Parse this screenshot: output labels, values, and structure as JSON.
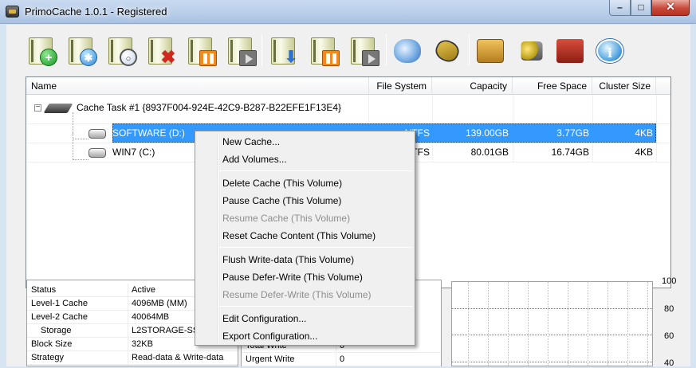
{
  "window": {
    "title": "PrimoCache 1.0.1 - Registered"
  },
  "title_bar_buttons": {
    "minimize": "–",
    "maximize": "□",
    "close": "✕"
  },
  "toolbar": [
    {
      "name": "new-cache-button",
      "icon": "disk-plus-icon",
      "overlay": "+"
    },
    {
      "name": "add-volumes-button",
      "icon": "disk-gear-icon",
      "overlay": "✱"
    },
    {
      "name": "volume-properties-button",
      "icon": "disk-magnifier-icon",
      "overlay": "○"
    },
    {
      "name": "delete-cache-button",
      "icon": "disk-delete-icon",
      "overlay": "✖"
    },
    {
      "name": "pause-cache-button",
      "icon": "disk-pause-icon",
      "overlay": ""
    },
    {
      "name": "resume-cache-button",
      "icon": "disk-play-icon",
      "overlay": ""
    },
    {
      "name": "flush-write-data-button",
      "icon": "disk-download-icon",
      "overlay": "⬇"
    },
    {
      "name": "pause-defer-write-button",
      "icon": "disk-pause-icon",
      "overlay": ""
    },
    {
      "name": "resume-defer-write-button",
      "icon": "disk-play-icon",
      "overlay": ""
    },
    {
      "name": "configuration-button",
      "icon": "gear-icon",
      "overlay": ""
    },
    {
      "name": "l2-storage-button",
      "icon": "chip-icon",
      "overlay": ""
    },
    {
      "name": "options-button",
      "icon": "box-gear-icon",
      "overlay": ""
    },
    {
      "name": "license-button",
      "icon": "keys-icon",
      "overlay": ""
    },
    {
      "name": "help-button",
      "icon": "book-icon",
      "overlay": ""
    },
    {
      "name": "about-button",
      "icon": "info-icon",
      "overlay": "i"
    }
  ],
  "volume_list": {
    "columns": [
      "Name",
      "File System",
      "Capacity",
      "Free Space",
      "Cluster Size"
    ],
    "task": {
      "label": "Cache Task #1 {8937F004-924E-42C9-B287-B22EFE1F13E4}",
      "expander": "−"
    },
    "rows": [
      {
        "name": "SOFTWARE (D:)",
        "fs": "NTFS",
        "capacity": "139.00GB",
        "free": "3.77GB",
        "cluster": "4KB",
        "selected": true
      },
      {
        "name": "WIN7 (C:)",
        "fs": "NTFS",
        "capacity": "80.01GB",
        "free": "16.74GB",
        "cluster": "4KB",
        "selected": false
      }
    ]
  },
  "cache_info": [
    {
      "key": "Status",
      "value": "Active",
      "indent": false
    },
    {
      "key": "Level-1 Cache",
      "value": "4096MB (MM)",
      "indent": false
    },
    {
      "key": "Level-2 Cache",
      "value": "40064MB",
      "indent": false
    },
    {
      "key": "Storage",
      "value": "L2STORAGE-SSD",
      "indent": true
    },
    {
      "key": "Block Size",
      "value": "32KB",
      "indent": false
    },
    {
      "key": "Strategy",
      "value": "Read-data & Write-data",
      "indent": false
    }
  ],
  "stats_panel": {
    "partial_key": "Total Write",
    "partial_value": "0",
    "key": "Urgent Write",
    "value": "0"
  },
  "graph": {
    "y_ticks": [
      "100",
      "80",
      "60",
      "40"
    ]
  },
  "context_menu": {
    "items": [
      {
        "label": "New Cache...",
        "enabled": true,
        "name": "menu-new-cache"
      },
      {
        "label": "Add Volumes...",
        "enabled": true,
        "name": "menu-add-volumes"
      },
      {
        "sep": true
      },
      {
        "label": "Delete Cache (This Volume)",
        "enabled": true,
        "name": "menu-delete-cache"
      },
      {
        "label": "Pause Cache (This Volume)",
        "enabled": true,
        "name": "menu-pause-cache"
      },
      {
        "label": "Resume Cache (This Volume)",
        "enabled": false,
        "name": "menu-resume-cache"
      },
      {
        "label": "Reset Cache Content (This Volume)",
        "enabled": true,
        "name": "menu-reset-cache"
      },
      {
        "sep": true
      },
      {
        "label": "Flush Write-data (This Volume)",
        "enabled": true,
        "name": "menu-flush-write-data"
      },
      {
        "label": "Pause Defer-Write (This Volume)",
        "enabled": true,
        "name": "menu-pause-defer-write"
      },
      {
        "label": "Resume Defer-Write (This Volume)",
        "enabled": false,
        "name": "menu-resume-defer-write"
      },
      {
        "sep": true
      },
      {
        "label": "Edit Configuration...",
        "enabled": true,
        "name": "menu-edit-configuration"
      },
      {
        "label": "Export Configuration...",
        "enabled": true,
        "name": "menu-export-configuration"
      }
    ]
  }
}
